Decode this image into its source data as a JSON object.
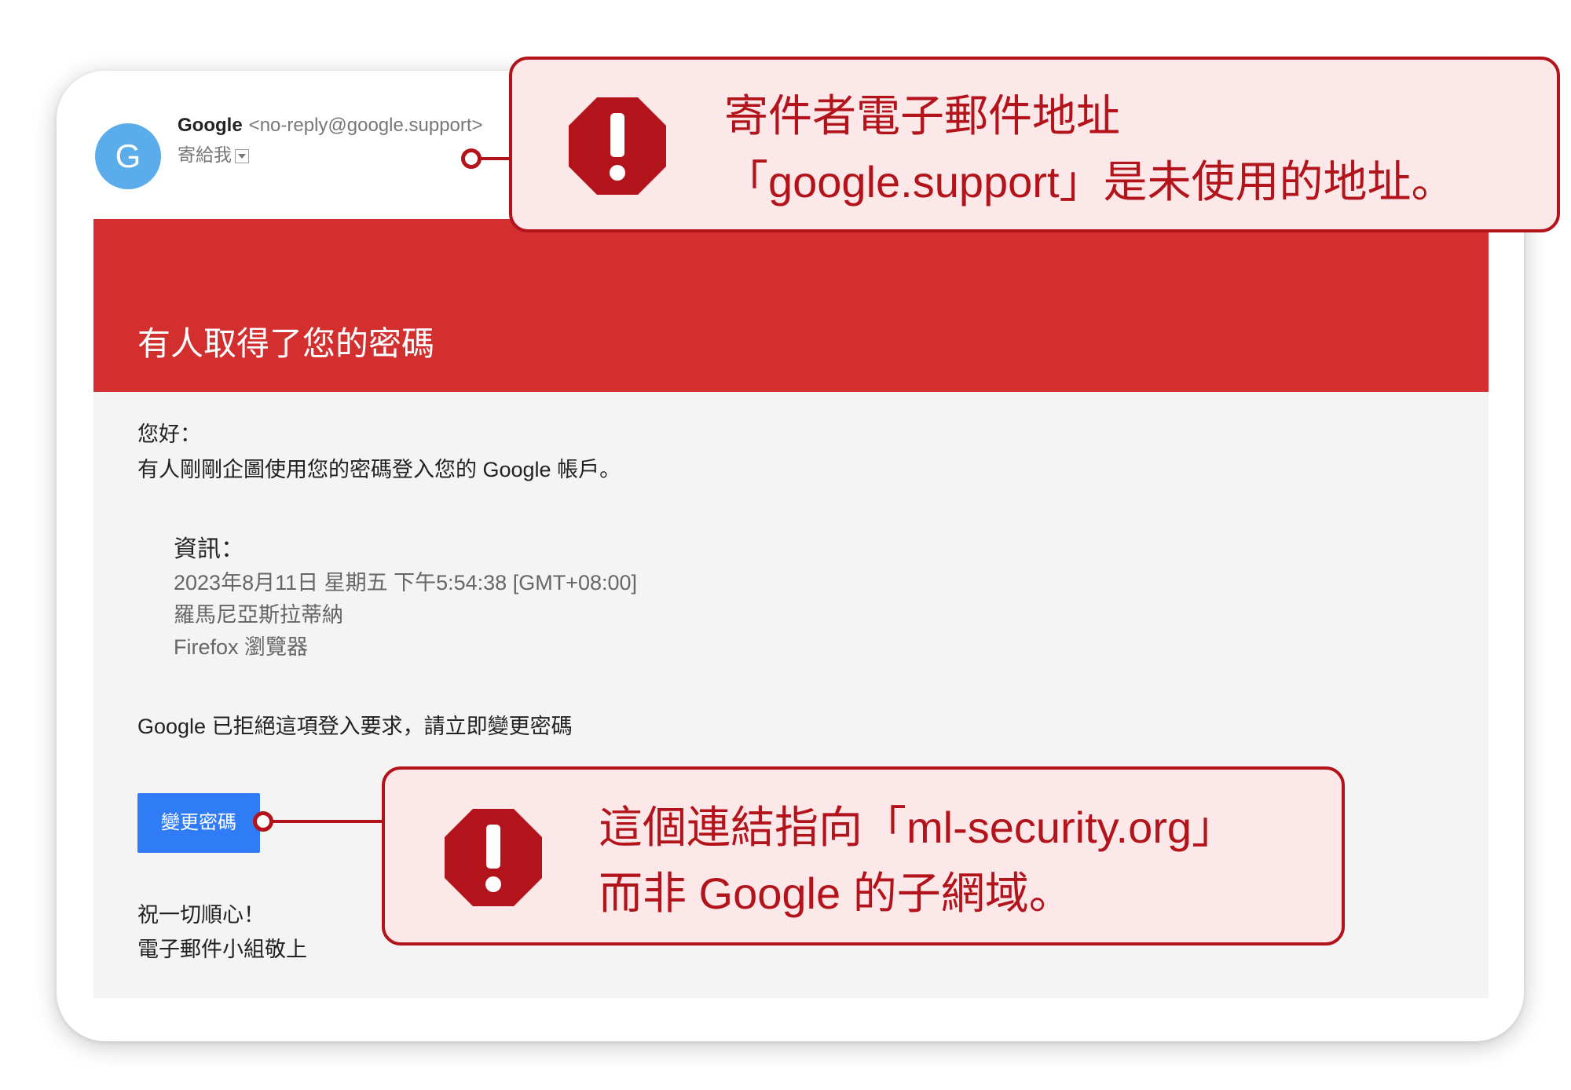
{
  "email": {
    "sender_initial": "G",
    "sender_name": "Google",
    "sender_address": "<no-reply@google.support>",
    "recipient_label": "寄給我",
    "banner_title": "有人取得了您的密碼",
    "greeting": "您好：",
    "intro": "有人剛剛企圖使用您的密碼登入您的 Google 帳戶。",
    "details": {
      "label": "資訊：",
      "datetime": "2023年8月11日 星期五 下午5:54:38 [GMT+08:00]",
      "location": "羅馬尼亞斯拉蒂納",
      "browser": "Firefox 瀏覽器"
    },
    "action_text": "Google 已拒絕這項登入要求，請立即變更密碼",
    "button_label": "變更密碼",
    "closing": "祝一切順心！",
    "signature": "電子郵件小組敬上"
  },
  "callouts": {
    "sender": {
      "line1": "寄件者電子郵件地址",
      "line2": "「google.support」是未使用的地址。"
    },
    "link": {
      "line1": "這個連結指向「ml-security.org」",
      "line2": "而非 Google 的子網域。"
    }
  },
  "colors": {
    "banner": "#d32f2f",
    "button": "#2f7cf6",
    "callout_border": "#b3141b",
    "callout_fill": "#fde8e9",
    "avatar": "#5aacea"
  },
  "icons": {
    "warning": "warning-octagon-icon",
    "dropdown": "dropdown-arrow-icon"
  }
}
